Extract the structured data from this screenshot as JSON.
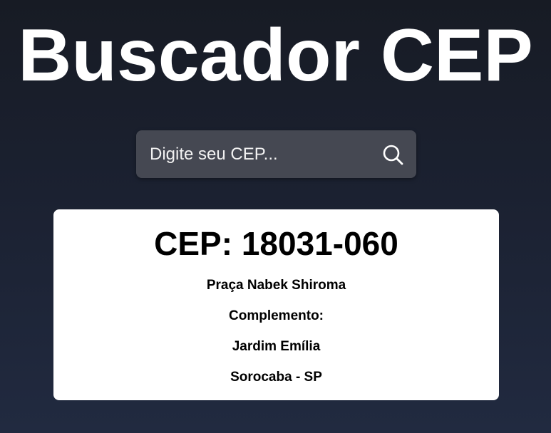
{
  "header": {
    "title": "Buscador CEP"
  },
  "search": {
    "placeholder": "Digite seu CEP...",
    "value": "",
    "icon": "search-icon"
  },
  "result": {
    "cep_label": "CEP: 18031-060",
    "street": "Praça Nabek Shiroma",
    "complement": "Complemento:",
    "neighborhood": "Jardim Emília",
    "city_state": "Sorocaba - SP"
  },
  "colors": {
    "background_top": "#171b24",
    "background_bottom": "#212a40",
    "search_box": "#454852",
    "card": "#ffffff",
    "title_text": "#ffffff"
  }
}
